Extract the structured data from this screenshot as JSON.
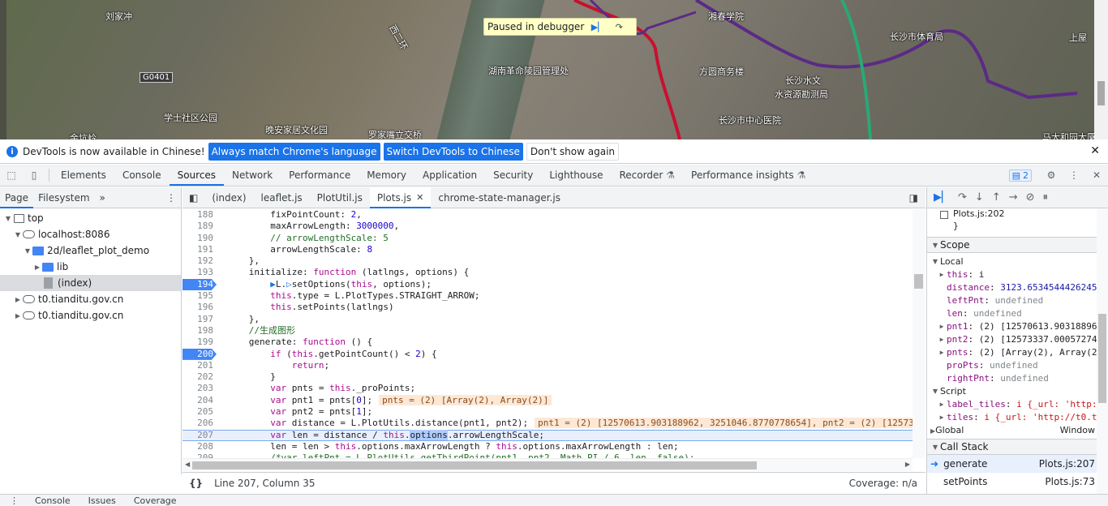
{
  "map": {
    "labels": [
      "刘家冲",
      "湖南革命陵园管理处",
      "方圆商务楼",
      "长沙水文",
      "水资源勘测局",
      "长沙市中心医院",
      "长沙市体育局",
      "学士社区公园",
      "晚安家居文化园",
      "罗家嘴立交桥",
      "湘春学院",
      "西二环",
      "上屋",
      "马大和园大厦",
      "金坑岭"
    ],
    "shield": "G0401"
  },
  "paused": {
    "text": "Paused in debugger"
  },
  "infobar": {
    "text": "DevTools is now available in Chinese!",
    "btn_match": "Always match Chrome's language",
    "btn_switch": "Switch DevTools to Chinese",
    "btn_dismiss": "Don't show again"
  },
  "panels": [
    "Elements",
    "Console",
    "Sources",
    "Network",
    "Performance",
    "Memory",
    "Application",
    "Security",
    "Lighthouse",
    "Recorder",
    "Performance insights"
  ],
  "issues_count": "2",
  "navigator": {
    "tabs": [
      "Page",
      "Filesystem"
    ],
    "tree": [
      "top",
      "localhost:8086",
      "2d/leaflet_plot_demo",
      "lib",
      "(index)",
      "t0.tianditu.gov.cn",
      "t0.tianditu.gov.cn"
    ]
  },
  "editor": {
    "tabs": [
      "(index)",
      "leaflet.js",
      "PlotUtil.js",
      "Plots.js",
      "chrome-state-manager.js"
    ],
    "lines": [
      "188",
      "189",
      "190",
      "191",
      "192",
      "193",
      "194",
      "195",
      "196",
      "197",
      "198",
      "199",
      "200",
      "201",
      "202",
      "203",
      "204",
      "205",
      "206",
      "207",
      "208",
      "209"
    ],
    "inline_204": "pnts = (2) [Array(2), Array(2)]",
    "inline_206": "pnt1 = (2) [12570613.903188962, 3251046.8770778654], pnt2 = (2) [125733"
  },
  "status": {
    "position": "Line 207, Column 35",
    "coverage": "Coverage: n/a"
  },
  "debugger": {
    "top_item": "Plots.js:202",
    "scope": "Scope",
    "local": "Local",
    "vars": [
      {
        "k": "this",
        "v": "i"
      },
      {
        "k": "distance",
        "v": "3123.6534544426245"
      },
      {
        "k": "leftPnt",
        "v": "undefined"
      },
      {
        "k": "len",
        "v": "undefined"
      },
      {
        "k": "pnt1",
        "v": "(2) [12570613.90318896"
      },
      {
        "k": "pnt2",
        "v": "(2) [12573337.00057274"
      },
      {
        "k": "pnts",
        "v": "(2) [Array(2), Array(2"
      },
      {
        "k": "proPts",
        "v": "undefined"
      },
      {
        "k": "rightPnt",
        "v": "undefined"
      }
    ],
    "script": "Script",
    "script_vars": [
      {
        "k": "label_tiles",
        "v": "i {_url: 'http:"
      },
      {
        "k": "tiles",
        "v": "i {_url: 'http://t0.t"
      }
    ],
    "global": "Global",
    "global_v": "Window",
    "callstack": "Call Stack",
    "frames": [
      {
        "fn": "generate",
        "loc": "Plots.js:207"
      },
      {
        "fn": "setPoints",
        "loc": "Plots.js:73"
      }
    ]
  },
  "drawer": [
    "Console",
    "Issues",
    "Coverage"
  ]
}
